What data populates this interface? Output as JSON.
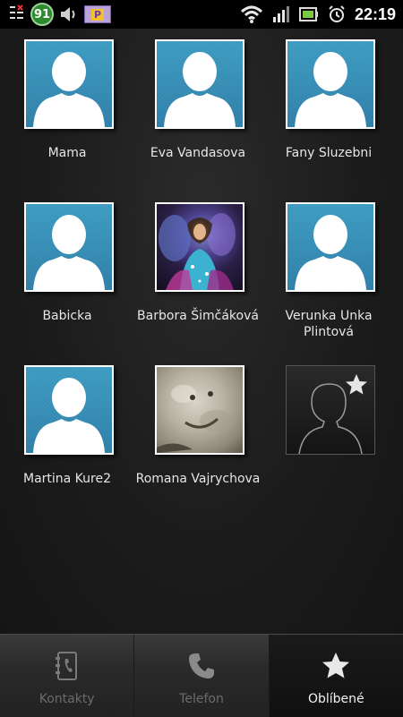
{
  "status_bar": {
    "notification_count": "91",
    "parking_badge": "P",
    "time": "22:19",
    "icons": [
      "task-manager-icon",
      "notification-badge-icon",
      "volume-icon",
      "parking-app-icon",
      "wifi-icon",
      "signal-icon",
      "battery-icon",
      "alarm-icon"
    ]
  },
  "favorites": [
    {
      "name": "Mama",
      "photo": "default-avatar"
    },
    {
      "name": "Eva Vandasova",
      "photo": "default-avatar"
    },
    {
      "name": "Fany Sluzebni",
      "photo": "default-avatar"
    },
    {
      "name": "Babicka",
      "photo": "default-avatar"
    },
    {
      "name": "Barbora Šimčáková",
      "photo": "custom-photo"
    },
    {
      "name": "Verunka Unka Plintová",
      "photo": "default-avatar"
    },
    {
      "name": "Martina Kure2",
      "photo": "default-avatar"
    },
    {
      "name": "Romana Vajrychova",
      "photo": "custom-photo"
    }
  ],
  "add_favorite": {
    "icon": "add-favorite-icon"
  },
  "tabs": [
    {
      "label": "Kontakty",
      "icon": "contacts-book-icon",
      "active": false
    },
    {
      "label": "Telefon",
      "icon": "phone-handset-icon",
      "active": false
    },
    {
      "label": "Oblíbené",
      "icon": "star-icon",
      "active": true
    }
  ],
  "colors": {
    "avatar_blue": "#3c9bc1",
    "background": "#1c1c1c",
    "active_tab_text": "#f2f2f2",
    "inactive_tab_text": "#6b6b6b"
  }
}
